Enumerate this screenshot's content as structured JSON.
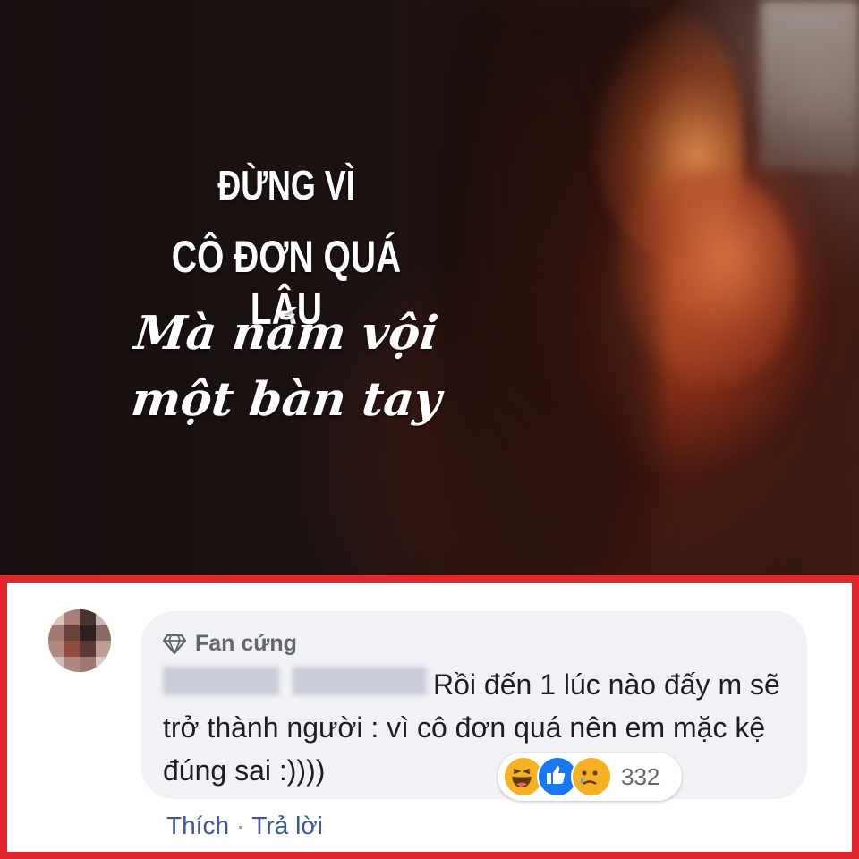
{
  "poster": {
    "line1": "ĐỪNG VÌ",
    "line2": "CÔ ĐƠN QUÁ LÂU",
    "line3": "Mà nắm vội",
    "line4": "một bàn tay"
  },
  "comment": {
    "badge_icon": "diamond-icon",
    "badge_label": "Fan cứng",
    "text": "Rồi đến 1 lúc nào đấy m sẽ trở thành người : vì cô đơn quá nên em mặc kệ đúng sai :))))",
    "reactions": {
      "icons": [
        "haha-icon",
        "like-icon",
        "sad-icon"
      ],
      "count": "332"
    },
    "actions": {
      "like_label": "Thích",
      "separator": "·",
      "reply_label": "Trả lời"
    }
  },
  "colors": {
    "frame_border": "#e3262c",
    "bubble_bg": "#f0f2f5",
    "action_link": "#385898"
  }
}
